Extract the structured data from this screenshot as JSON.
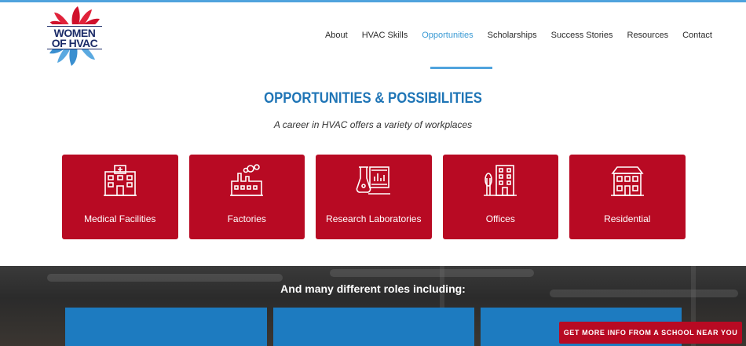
{
  "logo": {
    "line1": "WOMEN",
    "line2": "OF HVAC"
  },
  "nav": {
    "items": [
      {
        "label": "About"
      },
      {
        "label": "HVAC Skills"
      },
      {
        "label": "Opportunities",
        "active": true
      },
      {
        "label": "Scholarships"
      },
      {
        "label": "Success Stories"
      },
      {
        "label": "Resources"
      },
      {
        "label": "Contact"
      }
    ]
  },
  "main": {
    "title": "OPPORTUNITIES & POSSIBILITIES",
    "subtitle": "A career in HVAC offers a variety of workplaces",
    "cards": [
      {
        "label": "Medical Facilities",
        "icon": "hospital-icon"
      },
      {
        "label": "Factories",
        "icon": "factory-icon"
      },
      {
        "label": "Research Laboratories",
        "icon": "laboratory-icon"
      },
      {
        "label": "Offices",
        "icon": "office-building-icon"
      },
      {
        "label": "Residential",
        "icon": "house-icon"
      }
    ]
  },
  "roles": {
    "title": "And many different roles including:"
  },
  "cta": {
    "label": "GET MORE INFO FROM A SCHOOL NEAR YOU"
  },
  "colors": {
    "accent_blue": "#4fa3dd",
    "heading_blue": "#1f75b6",
    "brand_red": "#b80a23",
    "navy": "#1b2b68"
  }
}
